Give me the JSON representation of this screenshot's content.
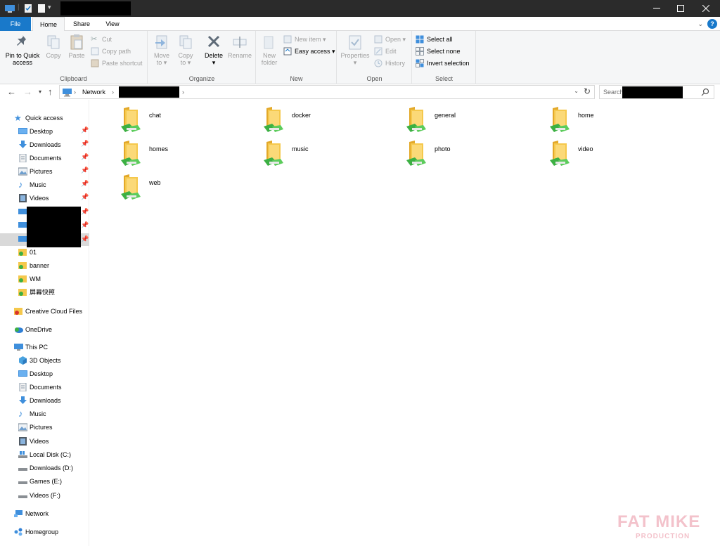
{
  "ribbon": {
    "tabs": {
      "file": "File",
      "home": "Home",
      "share": "Share",
      "view": "View"
    },
    "clipboard": {
      "label": "Clipboard",
      "pin_line1": "Pin to Quick",
      "pin_line2": "access",
      "copy": "Copy",
      "paste": "Paste",
      "cut": "Cut",
      "copy_path": "Copy path",
      "paste_shortcut": "Paste shortcut"
    },
    "organize": {
      "label": "Organize",
      "move_line1": "Move",
      "move_line2": "to",
      "copy_line1": "Copy",
      "copy_line2": "to",
      "delete": "Delete",
      "rename": "Rename"
    },
    "new": {
      "label": "New",
      "folder_line1": "New",
      "folder_line2": "folder",
      "new_item": "New item",
      "easy_access": "Easy access"
    },
    "open": {
      "label": "Open",
      "properties": "Properties",
      "open": "Open",
      "edit": "Edit",
      "history": "History"
    },
    "select": {
      "label": "Select",
      "select_all": "Select all",
      "select_none": "Select none",
      "invert": "Invert selection"
    }
  },
  "address": {
    "crumb_network": "Network",
    "search_placeholder": "Search"
  },
  "sidebar": {
    "quick_access": "Quick access",
    "quick_items": [
      "Desktop",
      "Downloads",
      "Documents",
      "Pictures",
      "Music",
      "Videos"
    ],
    "folders": [
      "01",
      "banner",
      "WM",
      "屏幕快照"
    ],
    "creative_cloud": "Creative Cloud Files",
    "onedrive": "OneDrive",
    "this_pc": "This PC",
    "pc_items": [
      "3D Objects",
      "Desktop",
      "Documents",
      "Downloads",
      "Music",
      "Pictures",
      "Videos",
      "Local Disk (C:)",
      "Downloads (D:)",
      "Games (E:)",
      "Videos (F:)"
    ],
    "network": "Network",
    "homegroup": "Homegroup"
  },
  "folders": [
    "chat",
    "docker",
    "general",
    "home",
    "homes",
    "music",
    "photo",
    "video",
    "web"
  ],
  "watermark": {
    "line1": "FAT MIKE",
    "line2": "PRODUCTION"
  },
  "colors": {
    "accent": "#1979ca",
    "titlebar": "#2b2b2b",
    "folder": "#f5c84c",
    "share_badge": "#3cb043"
  }
}
